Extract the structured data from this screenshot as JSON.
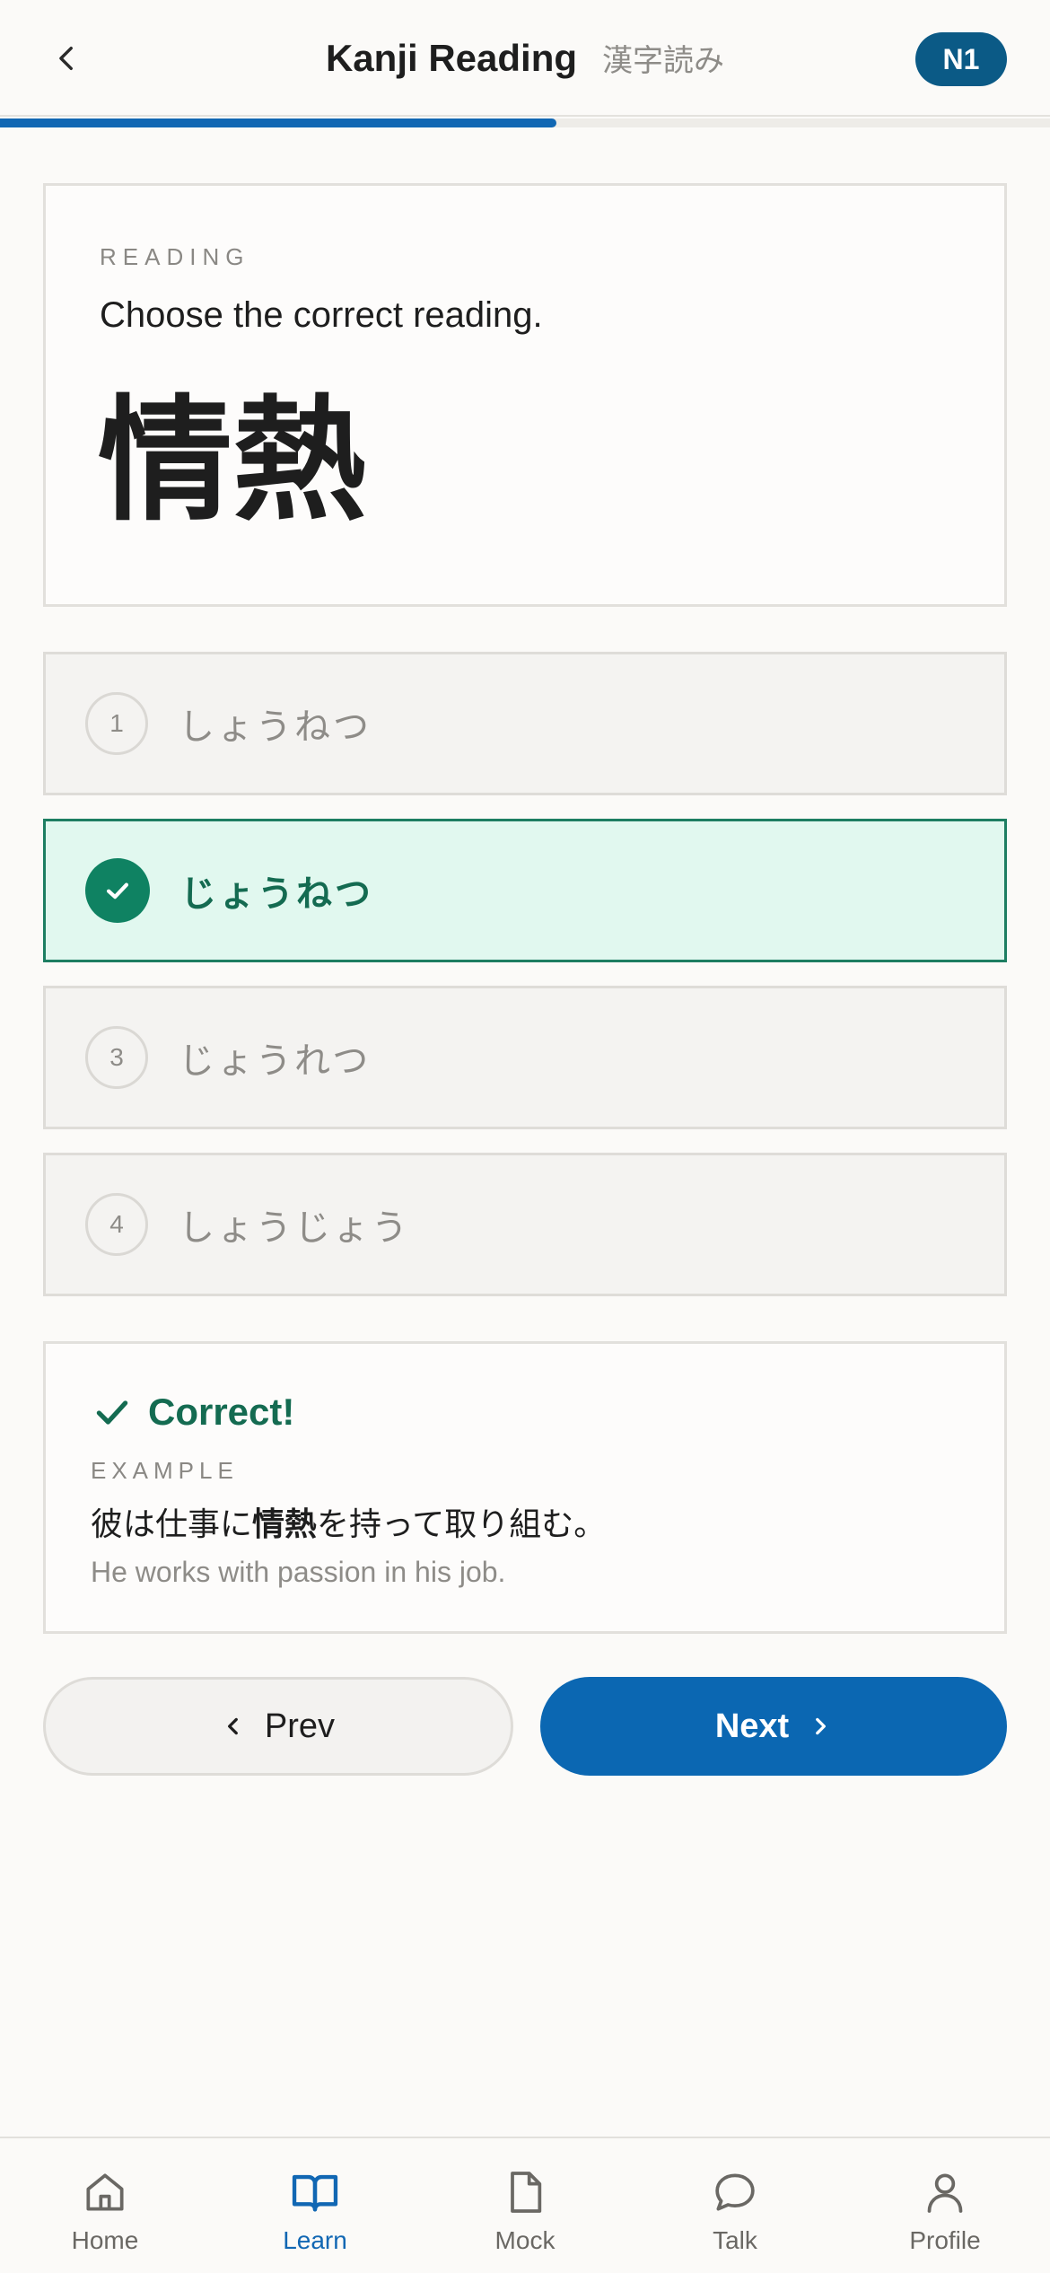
{
  "header": {
    "title": "Kanji Reading",
    "subtitle": "漢字読み",
    "level": "N1",
    "progress": 0.53
  },
  "question": {
    "label": "READING",
    "prompt": "Choose the correct reading.",
    "kanji": "情熱"
  },
  "options": [
    {
      "number": "1",
      "text": "しょうねつ",
      "state": "default"
    },
    {
      "number": "2",
      "text": "じょうねつ",
      "state": "correct"
    },
    {
      "number": "3",
      "text": "じょうれつ",
      "state": "default"
    },
    {
      "number": "4",
      "text": "しょうじょう",
      "state": "default"
    }
  ],
  "feedback": {
    "title": "Correct!",
    "example_label": "EXAMPLE",
    "sentence_before": "彼は仕事に",
    "sentence_highlight": "情熱",
    "sentence_after": "を持って取り組む。",
    "translation": "He works with passion in his job."
  },
  "nav": {
    "prev_label": "Prev",
    "next_label": "Next"
  },
  "tabbar": {
    "items": [
      {
        "label": "Home",
        "icon": "home-icon",
        "active": false
      },
      {
        "label": "Learn",
        "icon": "book-icon",
        "active": true
      },
      {
        "label": "Mock",
        "icon": "document-icon",
        "active": false
      },
      {
        "label": "Talk",
        "icon": "chat-bubble-icon",
        "active": false
      },
      {
        "label": "Profile",
        "icon": "person-icon",
        "active": false
      }
    ]
  },
  "colors": {
    "accent": "#1167b3",
    "badge": "#0b5a86",
    "correct": "#0f8262",
    "correct_bg": "#e1f8ef",
    "background": "#fbfaf8"
  }
}
